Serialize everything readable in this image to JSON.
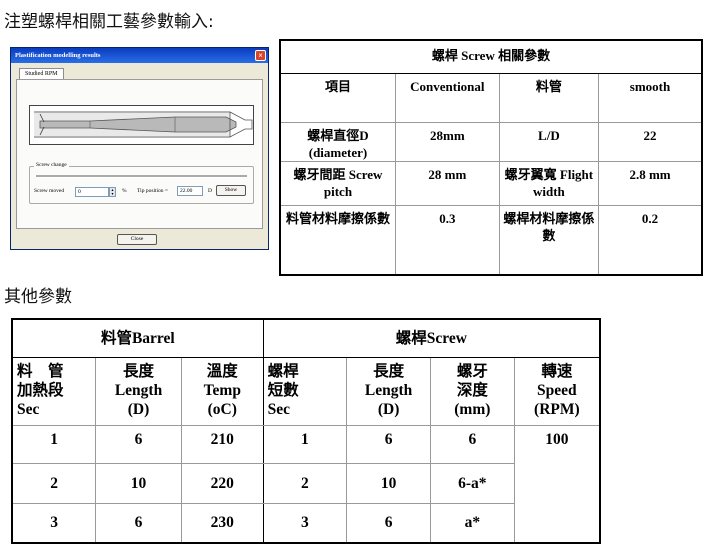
{
  "headings": {
    "injection_params": "注塑螺桿相關工藝參數輸入:",
    "other_params": "其他參數"
  },
  "dialog": {
    "title": "Plastification modelling results",
    "tab": "Studied RPM",
    "screw_change": "Screw change",
    "screw_moved_label": "Screw moved",
    "screw_moved_value": "0",
    "percent_unit": "%",
    "tip_position_label": "Tip position =",
    "tip_position_value": "22.00",
    "tip_unit": "D",
    "show_button": "Show",
    "close_button": "Close"
  },
  "screw_table": {
    "title": "螺桿 Screw 相關參數",
    "header": [
      "項目",
      "Conventional",
      "料管",
      "smooth"
    ],
    "rows": [
      [
        "螺桿直徑D (diameter)",
        "28mm",
        "L/D",
        "22"
      ],
      [
        "螺牙間距 Screw pitch",
        "28 mm",
        "螺牙翼寬 Flight width",
        "2.8 mm"
      ],
      [
        "料管材料摩擦係數",
        "0.3",
        "螺桿材料摩擦係數",
        "0.2"
      ]
    ]
  },
  "other_table": {
    "barrel_group": "料管Barrel",
    "screw_group": "螺桿Screw",
    "headers": {
      "barrel_sec": [
        "料　管",
        "加熱段",
        "Sec"
      ],
      "barrel_length": [
        "長度",
        "Length",
        "(D)"
      ],
      "barrel_temp": [
        "溫度",
        "Temp",
        "(oC)"
      ],
      "screw_sec": [
        "螺桿",
        "短數",
        "Sec"
      ],
      "screw_length": [
        "長度",
        "Length",
        "(D)"
      ],
      "screw_depth": [
        "螺牙",
        "深度",
        "(mm)"
      ],
      "speed": [
        "轉速",
        "Speed",
        "(RPM)"
      ]
    },
    "rows": [
      [
        "1",
        "6",
        "210",
        "1",
        "6",
        "6"
      ],
      [
        "2",
        "10",
        "220",
        "2",
        "10",
        "6-a*"
      ],
      [
        "3",
        "6",
        "230",
        "3",
        "6",
        "a*"
      ]
    ],
    "speed_value": "100"
  }
}
